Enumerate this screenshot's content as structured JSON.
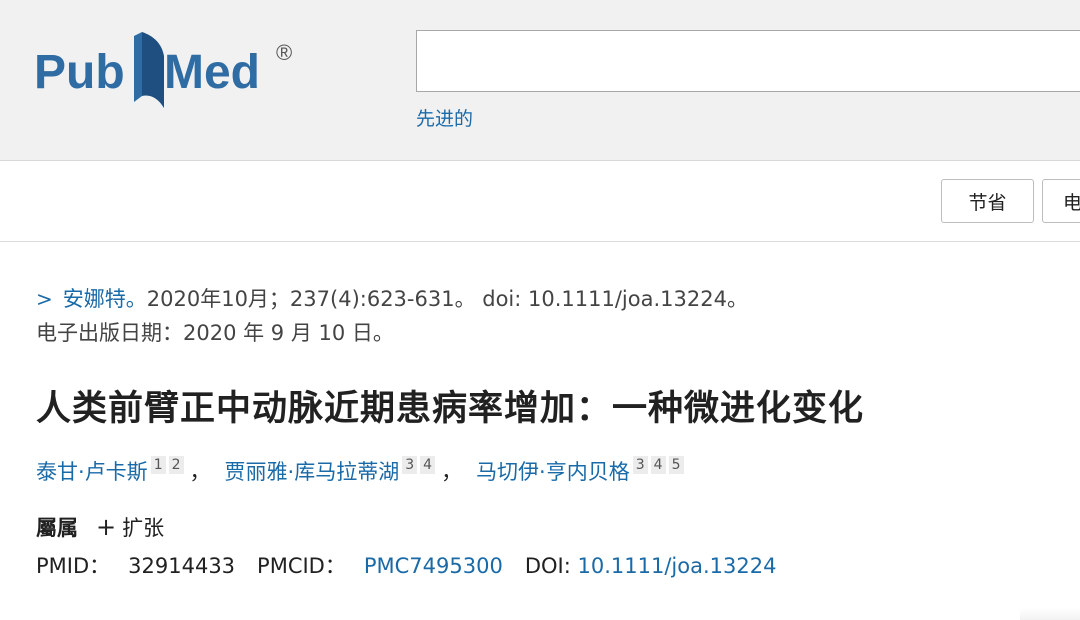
{
  "header": {
    "logo_text": "PubMed",
    "logo_mark": "®",
    "search_placeholder": "",
    "advanced_label": "先进的"
  },
  "toolbar": {
    "save_label": "节省",
    "email_label": "电"
  },
  "citation": {
    "journal": "安娜特。",
    "details": "2020年10月；237(4):623-631。 doi: 10.1111/joa.13224。",
    "epub": "电子出版日期：2020 年 9 月 10 日。"
  },
  "article": {
    "title": "人类前臂正中动脉近期患病率增加：一种微进化变化",
    "authors": [
      {
        "name": "泰甘·卢卡斯",
        "affils": [
          "1",
          "2"
        ]
      },
      {
        "name": "贾丽雅·库马拉蒂湖",
        "affils": [
          "3",
          "4"
        ]
      },
      {
        "name": "马切伊·亨内贝格",
        "affils": [
          "3",
          "4",
          "5"
        ]
      }
    ],
    "author_separator": "，"
  },
  "affiliations": {
    "label": "屬属",
    "expand_icon": "plus-icon",
    "expand_label": "扩张"
  },
  "identifiers": {
    "pmid_label": "PMID：",
    "pmid": "32914433",
    "pmcid_label": "PMCID：",
    "pmcid": "PMC7495300",
    "doi_label": "DOI:",
    "doi": "10.1111/joa.13224"
  },
  "colors": {
    "link": "#1a6aa8",
    "logo_blue": "#2f6ca3",
    "header_bg": "#f1f1f1"
  }
}
